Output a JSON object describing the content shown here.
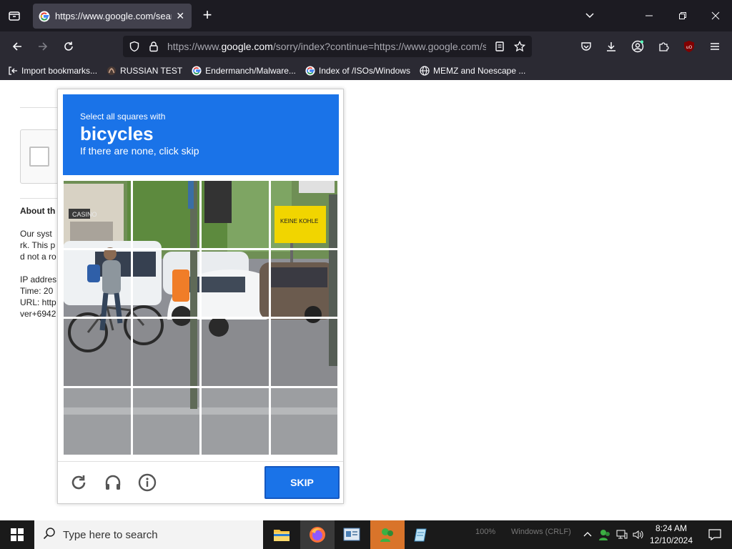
{
  "tab": {
    "title": "https://www.google.com/search",
    "close": "✕"
  },
  "url": {
    "prefix": "https://www.",
    "domain": "google.com",
    "rest": "/sorry/index?continue=https://www.google.com/search"
  },
  "bookmarks": [
    {
      "label": "Import bookmarks...",
      "icon": "import-icon"
    },
    {
      "label": "RUSSIAN TEST",
      "icon": "github-icon"
    },
    {
      "label": "Endermanch/Malware...",
      "icon": "google-icon"
    },
    {
      "label": "Index of /ISOs/Windows",
      "icon": "google-icon"
    },
    {
      "label": "MEMZ and Noescape ...",
      "icon": "globe-icon"
    }
  ],
  "page": {
    "about_title": "About th",
    "lines": [
      "Our syst",
      "rk. This p",
      "d not a ro",
      "",
      "IP addres",
      "Time: 20",
      "URL: http",
      "ver+6942"
    ]
  },
  "captcha": {
    "line1": "Select all squares with",
    "object": "bicycles",
    "line3": "If there are none, click skip",
    "skip": "SKIP",
    "icons": [
      "reload-icon",
      "audio-icon",
      "info-icon"
    ]
  },
  "taskbar": {
    "search_placeholder": "Type here to search",
    "tray_zoom": "100%",
    "tray_encoding": "Windows (CRLF)",
    "time": "8:24 AM",
    "date": "12/10/2024"
  },
  "colors": {
    "accent": "#1a73e8",
    "chrome_dark": "#1c1b22",
    "chrome": "#2b2a33"
  }
}
